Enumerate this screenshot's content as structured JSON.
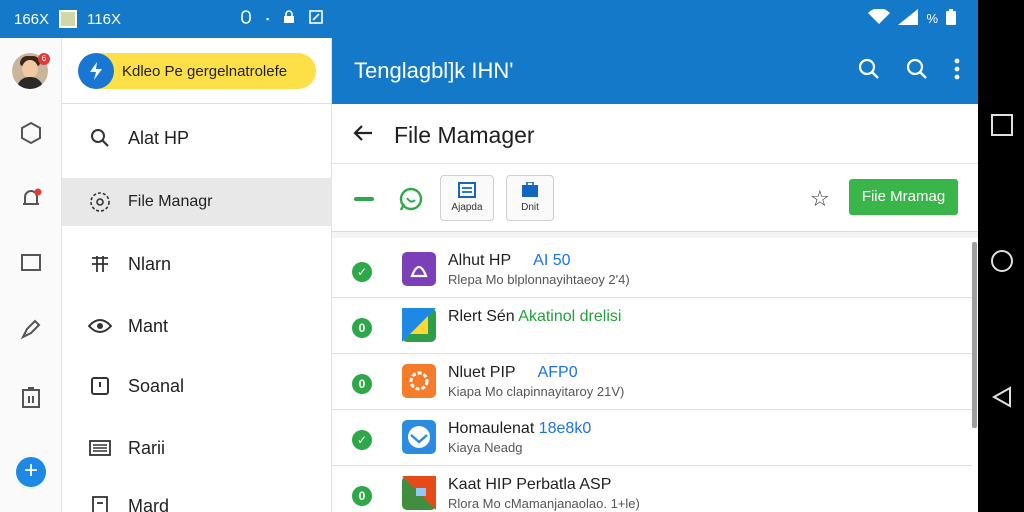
{
  "status_bar": {
    "left_label": "166X",
    "left_label_2": "116X",
    "battery_text": "%"
  },
  "rail": {
    "avatar_badge": "6",
    "items": [
      {
        "name": "hexagon-icon"
      },
      {
        "name": "notifications-icon"
      },
      {
        "name": "message-square-icon"
      },
      {
        "name": "pen-tool-icon"
      },
      {
        "name": "clipboard-icon"
      },
      {
        "name": "add-icon"
      }
    ]
  },
  "drawer": {
    "header_label": "Kdleo Pe gergelnatrolefe",
    "items": [
      {
        "label": "Alat HP",
        "icon": "search-icon"
      },
      {
        "label": "File Managr",
        "icon": "settings-compass-icon",
        "active": true
      },
      {
        "label": "Nlarn",
        "icon": "tools-icon"
      },
      {
        "label": "Mant",
        "icon": "eye-icon"
      },
      {
        "label": "Soanal",
        "icon": "square-dot-icon"
      },
      {
        "label": "Rarii",
        "icon": "keyboard-icon"
      },
      {
        "label": "Mard",
        "icon": "document-icon"
      }
    ]
  },
  "appbar": {
    "title": "Tenglagbl]k IHN'"
  },
  "subbar": {
    "title": "File Mamager"
  },
  "toolbar": {
    "card1_label": "Ajapda",
    "card2_label": "Dnit",
    "button_label": "Fiie Mramag"
  },
  "list": [
    {
      "title": "Alhut HP",
      "accent": "AI 50",
      "subtitle": "Rlepa Mo blplonnayihtaeoy 2'4)",
      "icon_color": "#7b3fb8"
    },
    {
      "title": "Rlert Sén ",
      "green": "Akatinol drelisi",
      "subtitle": "",
      "icon_color": "#2e9e4a"
    },
    {
      "title": "Nluet PIP",
      "accent": "AFP0",
      "subtitle": "Kiapa Mo clapinnayitaroy 21V)",
      "icon_color": "#f57c2a"
    },
    {
      "title": "Homaulenat ",
      "accent_inline": "18e8k0",
      "subtitle": "Kiaya Neadg",
      "icon_color": "#2b8be0"
    },
    {
      "title": "Kaat HIP Perbatla ASP",
      "subtitle": "Rlora Mo cMamanjanaolao. 1+le)",
      "icon_color": "#3f8f3f"
    }
  ]
}
